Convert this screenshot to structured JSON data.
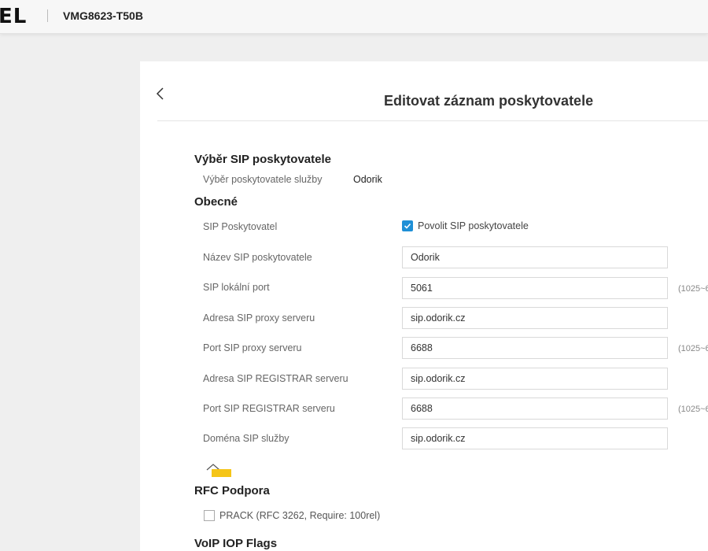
{
  "header": {
    "brand": "EL",
    "model": "VMG8623-T50B"
  },
  "page": {
    "title": "Editovat záznam poskytovatele"
  },
  "provider_selection": {
    "section_title": "Výběr SIP poskytovatele",
    "label": "Výběr poskytovatele služby",
    "value": "Odorik"
  },
  "general": {
    "section_title": "Obecné",
    "enable_label": "SIP Poskytovatel",
    "enable_checkbox_text": "Povolit SIP poskytovatele",
    "enable_checked": true,
    "fields": [
      {
        "label": "Název SIP poskytovatele",
        "value": "Odorik",
        "hint": ""
      },
      {
        "label": "SIP lokální port",
        "value": "5061",
        "hint": "(1025~6"
      },
      {
        "label": "Adresa SIP proxy serveru",
        "value": "sip.odorik.cz",
        "hint": ""
      },
      {
        "label": "Port SIP proxy serveru",
        "value": "6688",
        "hint": "(1025~6"
      },
      {
        "label": "Adresa SIP REGISTRAR serveru",
        "value": "sip.odorik.cz",
        "hint": ""
      },
      {
        "label": "Port SIP REGISTRAR serveru",
        "value": "6688",
        "hint": "(1025~6"
      },
      {
        "label": "Doména SIP služby",
        "value": "sip.odorik.cz",
        "hint": ""
      }
    ]
  },
  "rfc": {
    "section_title": "RFC Podpora",
    "prack_label": "PRACK (RFC 3262, Require: 100rel)",
    "prack_checked": false
  },
  "voip": {
    "section_title": "VoIP IOP Flags"
  },
  "colors": {
    "accent": "#1e8fd6",
    "expand_icon": "#f5c518"
  }
}
